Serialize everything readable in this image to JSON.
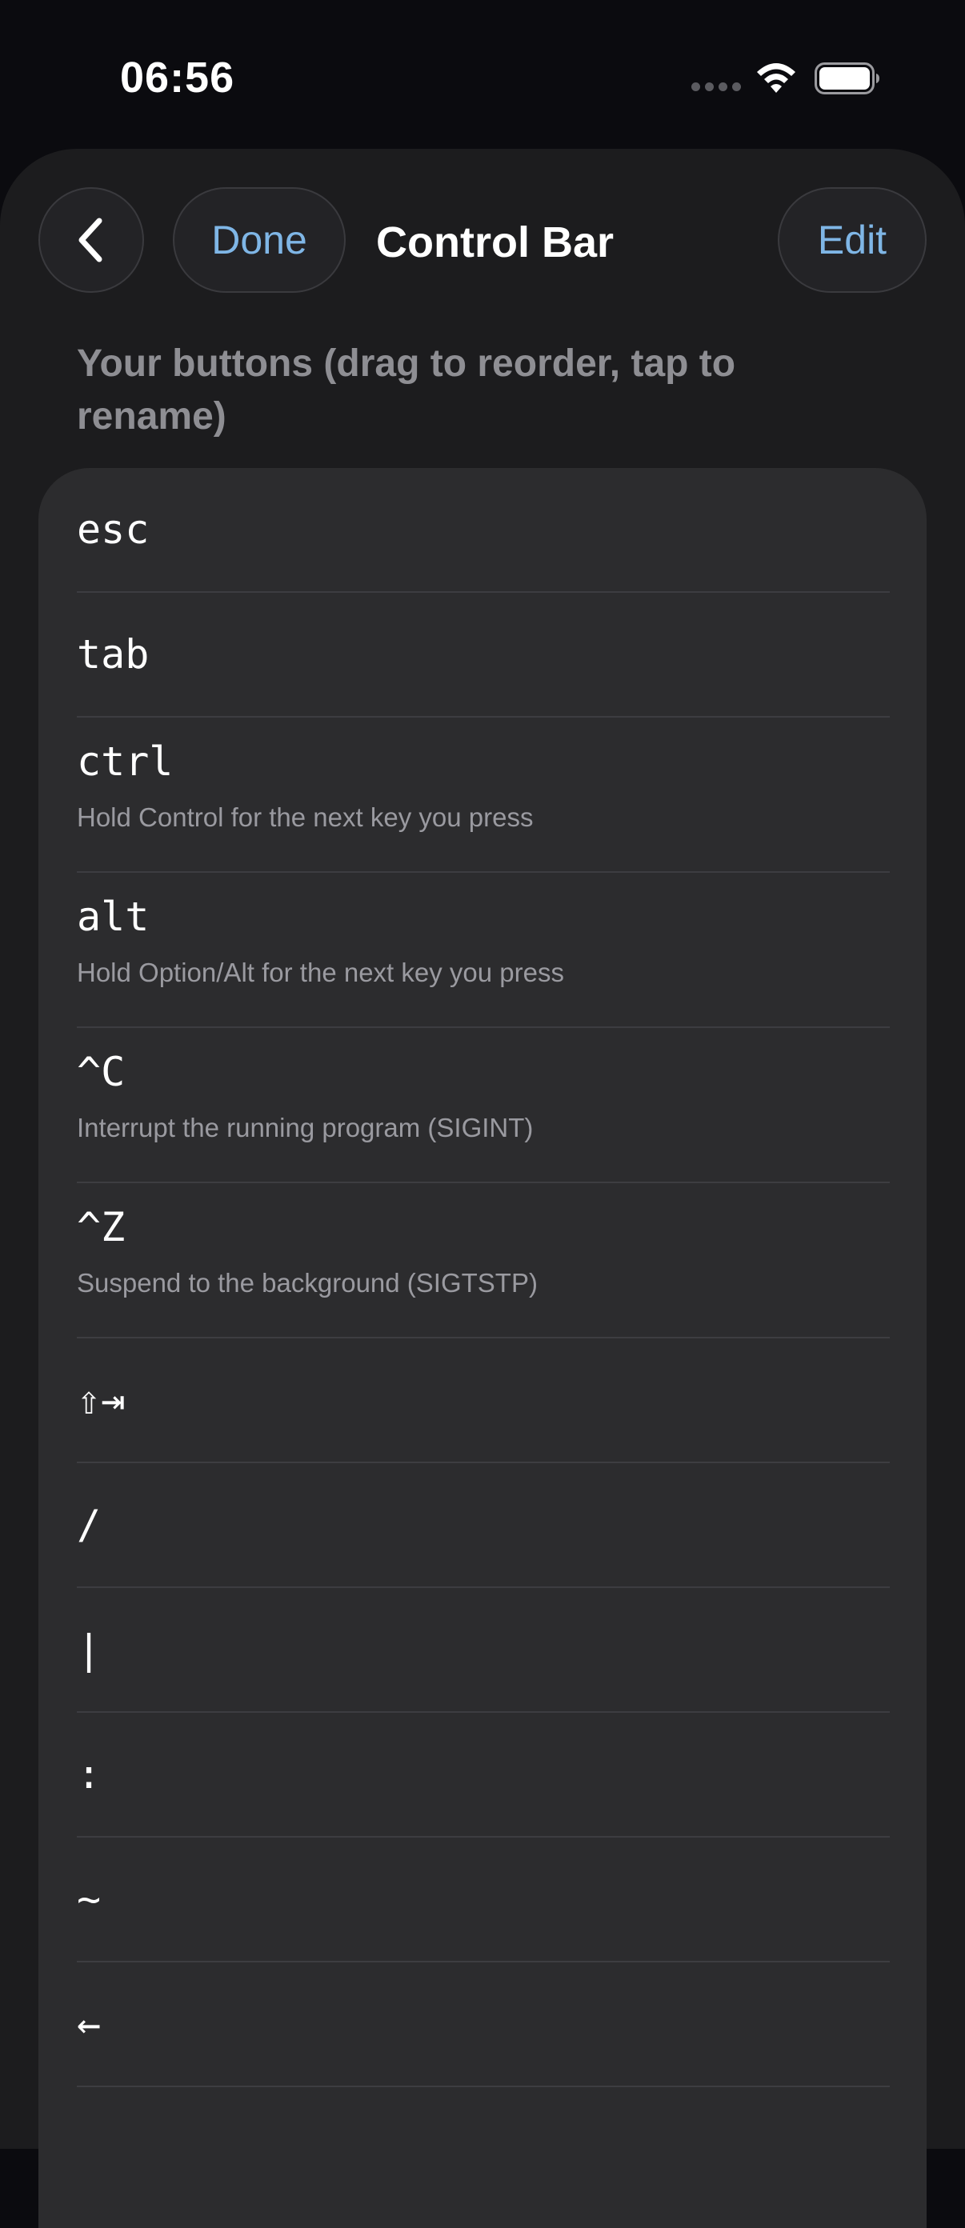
{
  "status_bar": {
    "time": "06:56"
  },
  "nav": {
    "done_label": "Done",
    "title": "Control Bar",
    "edit_label": "Edit"
  },
  "section": {
    "header": "Your buttons (drag to reorder, tap to rename)"
  },
  "buttons": [
    {
      "label": "esc",
      "description": ""
    },
    {
      "label": "tab",
      "description": ""
    },
    {
      "label": "ctrl",
      "description": "Hold Control for the next key you press"
    },
    {
      "label": "alt",
      "description": "Hold Option/Alt for the next key you press"
    },
    {
      "label": "^C",
      "description": "Interrupt the running program (SIGINT)"
    },
    {
      "label": "^Z",
      "description": "Suspend to the background (SIGTSTP)"
    },
    {
      "label": "⇧⇥",
      "description": ""
    },
    {
      "label": "/",
      "description": ""
    },
    {
      "label": "|",
      "description": ""
    },
    {
      "label": ":",
      "description": ""
    },
    {
      "label": "~",
      "description": ""
    },
    {
      "label": "←",
      "description": ""
    }
  ],
  "colors": {
    "accent": "#7fb6e6",
    "background": "#1c1c1e",
    "card": "#2c2c2e",
    "secondary_text": "#8e8e93"
  },
  "icons": {
    "back": "chevron-left-icon",
    "wifi": "wifi-icon",
    "battery": "battery-icon",
    "cellular": "cellular-dots-icon"
  }
}
